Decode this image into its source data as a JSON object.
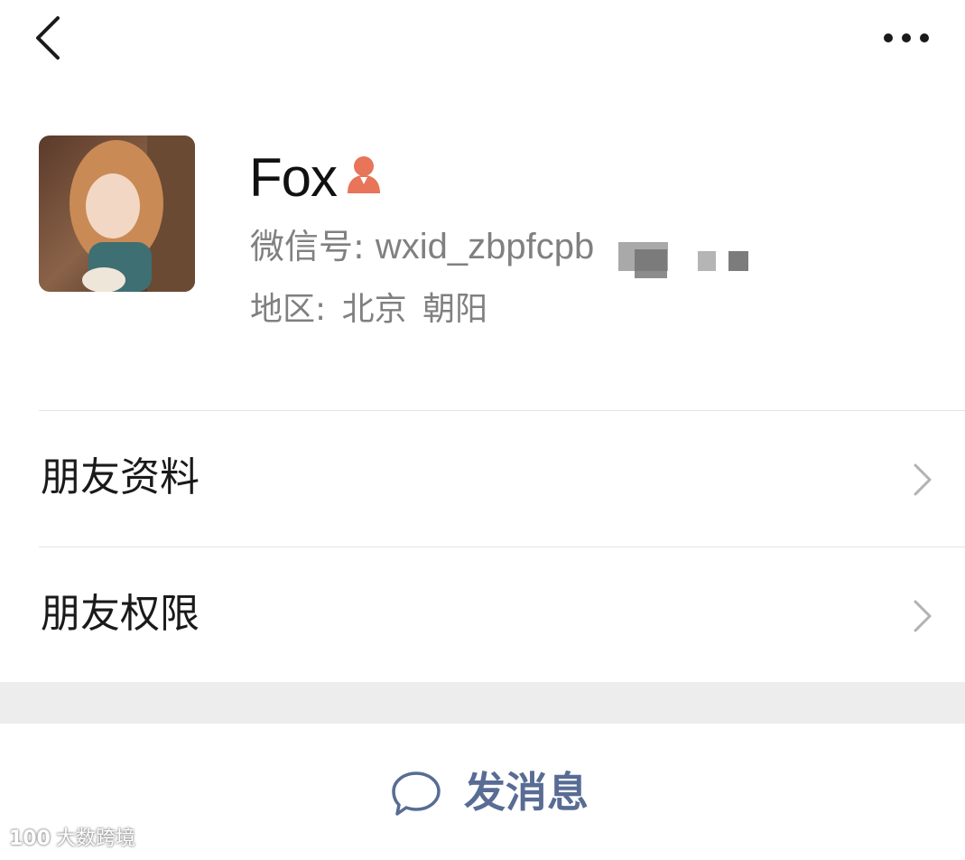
{
  "header": {
    "back_icon": "chevron-left-icon",
    "more_icon": "ellipsis-icon"
  },
  "profile": {
    "name": "Fox",
    "gender_icon": "female-person-icon",
    "wxid_label": "微信号:",
    "wxid_value": "wxid_zbpfcpb",
    "region_label": "地区:",
    "region_province": "北京",
    "region_city": "朝阳"
  },
  "menu": {
    "items": [
      {
        "label": "朋友资料",
        "icon": "chevron-right-icon"
      },
      {
        "label": "朋友权限",
        "icon": "chevron-right-icon"
      }
    ]
  },
  "action": {
    "send_label": "发消息",
    "send_icon": "chat-bubble-icon"
  },
  "watermark": {
    "logo": "100",
    "text": "大数跨境"
  },
  "colors": {
    "accent_link": "#586c94",
    "gender_female": "#e8745a",
    "secondary_text": "#808080",
    "separator_band": "#ededed"
  }
}
